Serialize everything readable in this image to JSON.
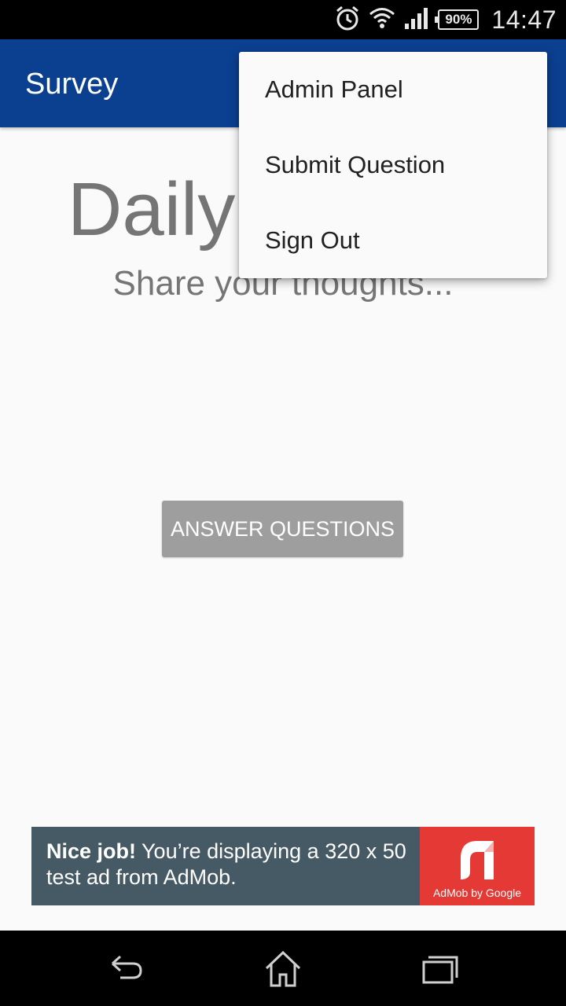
{
  "status_bar": {
    "battery": "90%",
    "time": "14:47",
    "icons": [
      "alarm-icon",
      "wifi-icon",
      "signal-icon",
      "battery-icon"
    ]
  },
  "app_bar": {
    "title": "Survey"
  },
  "main": {
    "headline": "Daily",
    "subtitle": "Share your thoughts...",
    "answer_button": "ANSWER QUESTIONS"
  },
  "overflow_menu": {
    "items": [
      {
        "label": "Admin Panel"
      },
      {
        "label": "Submit Question"
      },
      {
        "label": "Sign Out"
      }
    ]
  },
  "ad": {
    "bold": "Nice job!",
    "text": " You’re displaying a 320 x 50 test ad from AdMob.",
    "logo_label": "AdMob by Google"
  },
  "nav_bar": {
    "icons": [
      "back-icon",
      "home-icon",
      "recents-icon"
    ]
  },
  "colors": {
    "app_bar": "#0b3f8f",
    "button": "#9e9e9e",
    "ad_background": "#455a64",
    "ad_logo": "#e53935"
  }
}
